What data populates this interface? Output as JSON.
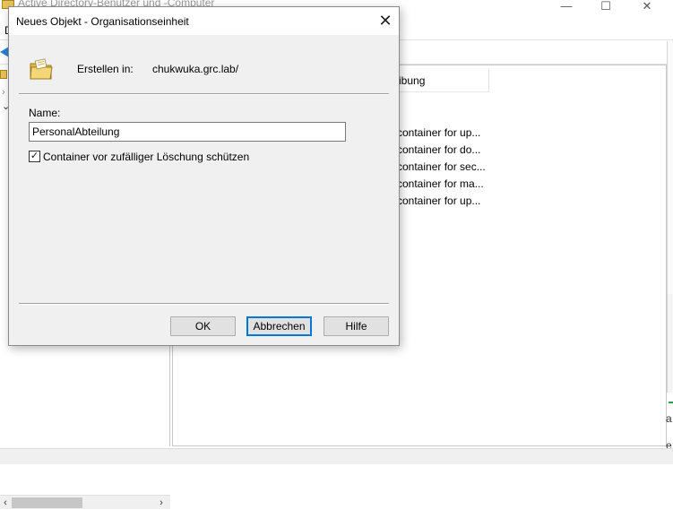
{
  "background_window": {
    "title": "Active Directory-Benutzer und -Computer",
    "menu_first_letter": "D",
    "controls": {
      "minimize": "—",
      "maximize": "☐",
      "close": "✕"
    },
    "tree": {
      "expander_1": "›",
      "expander_2": "⌄",
      "scroll_left": "‹",
      "scroll_right": "›"
    },
    "list": {
      "column_header_fragment": "ibung",
      "rows": [
        "container for up...",
        "container for do...",
        "container for sec...",
        "container for ma...",
        "container for up..."
      ]
    },
    "right_edge_letters": [
      "a",
      "e"
    ]
  },
  "dialog": {
    "title": "Neues Objekt - Organisationseinheit",
    "close_glyph": "✕",
    "create_in_label": "Erstellen in:",
    "create_in_value": "chukwuka.grc.lab/",
    "name_label": "Name:",
    "name_value": "PersonalAbteilung",
    "protect_checkbox_checked": true,
    "protect_checkbox_glyph": "✓",
    "protect_label": "Container vor zufälliger Löschung schützen",
    "buttons": {
      "ok": "OK",
      "cancel": "Abbrechen",
      "help": "Hilfe"
    },
    "icon": "organizational-unit-icon"
  },
  "colors": {
    "accent": "#0078d7",
    "dialog_bg": "#f0f0f0",
    "folder": "#e8c25a"
  }
}
